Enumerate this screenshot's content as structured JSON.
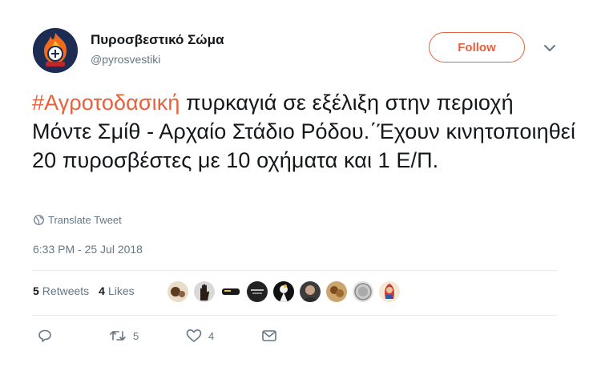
{
  "account": {
    "name": "Πυροσβεστικό Σώμα",
    "handle": "@pyrosvestiki",
    "avatar_icon": "fire-service-emblem"
  },
  "follow_button": {
    "label": "Follow",
    "color": "#e8603c"
  },
  "tweet": {
    "hashtag": "#Αγροτοδασική",
    "text": " πυρκαγιά σε εξέλιξη στην περιοχή Μόντε Σμίθ - Αρχαίο Στάδιο Ρόδου.΄Έχουν κινητοποιηθεί 20 πυροσβέστες με 10 οχήματα και 1 Ε/Π."
  },
  "translate_label": "Translate Tweet",
  "timestamp": "6:33 PM - 25 Jul 2018",
  "stats": {
    "retweets_count": "5",
    "retweets_label": "Retweets",
    "likes_count": "4",
    "likes_label": "Likes"
  },
  "liker_avatars": [
    "avatar-1",
    "avatar-2",
    "avatar-3",
    "avatar-4",
    "avatar-5",
    "avatar-6",
    "avatar-7",
    "avatar-8",
    "avatar-9"
  ],
  "actions": {
    "reply_count": "",
    "retweet_count": "5",
    "like_count": "4",
    "dm_count": ""
  },
  "colors": {
    "accent": "#e8603c",
    "muted": "#657786",
    "text": "#14171a"
  }
}
